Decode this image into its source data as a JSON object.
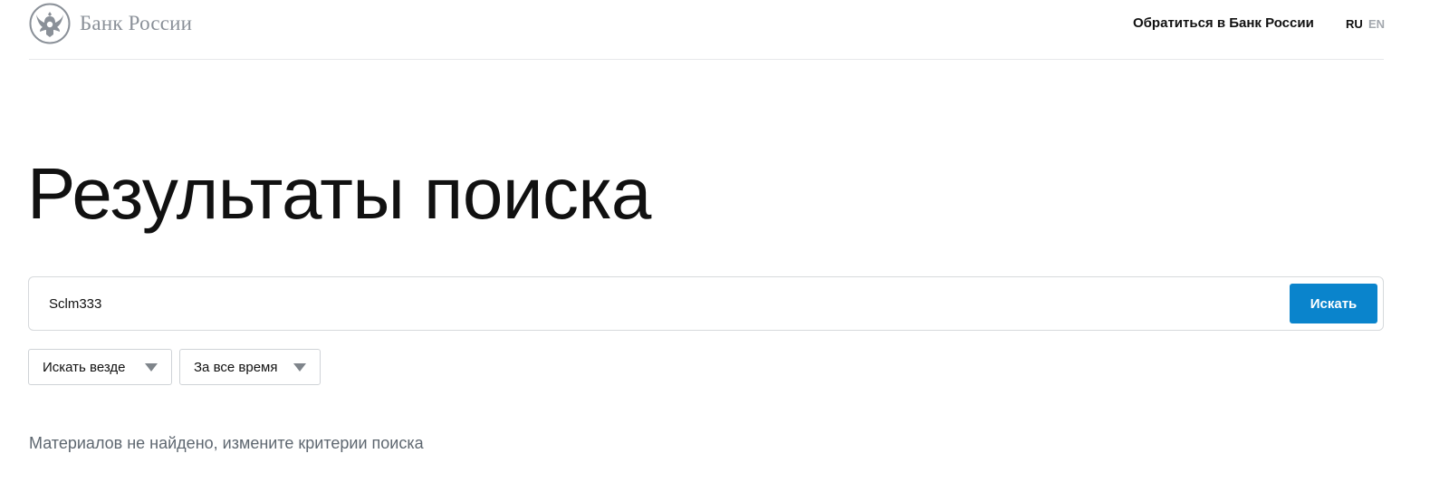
{
  "header": {
    "logo_text": "Банк России",
    "contact_label": "Обратиться в Банк России",
    "lang_ru": "RU",
    "lang_en": "EN",
    "logo_icon": "eagle-emblem-icon"
  },
  "main": {
    "title": "Результаты поиска",
    "search": {
      "value": "Sclm333",
      "button_label": "Искать"
    },
    "filters": {
      "where_label": "Искать везде",
      "time_label": "За все время"
    },
    "empty_message": "Материалов не найдено, измените критерии поиска"
  },
  "colors": {
    "accent": "#0a84cc",
    "muted_text": "#5e6770",
    "logo_gray": "#8a9098"
  }
}
